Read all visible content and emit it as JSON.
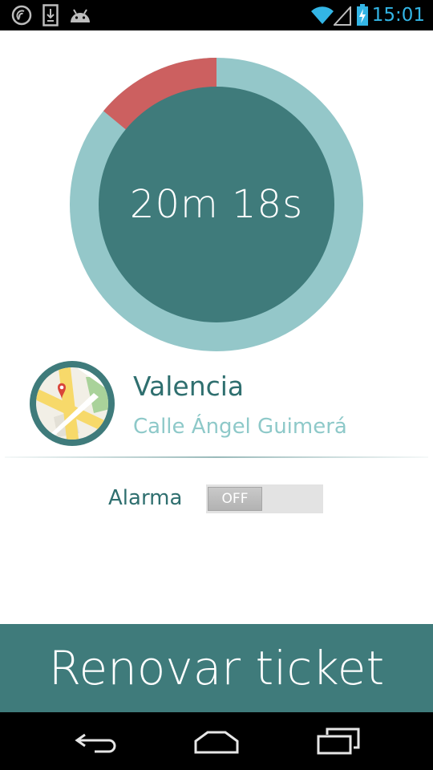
{
  "status_bar": {
    "time": "15:01",
    "left_icons": [
      "signal-scan-icon",
      "download-icon",
      "android-icon"
    ],
    "right_icons": [
      "wifi-icon",
      "cell-signal-icon",
      "battery-charging-icon"
    ],
    "accent_color": "#33b5e5"
  },
  "timer": {
    "remaining": "20m 18s",
    "elapsed_fraction": 0.14,
    "colors": {
      "ring": "#94c7c9",
      "elapsed": "#cc6060",
      "center": "#3f7b7b"
    }
  },
  "location": {
    "icon": "map-icon",
    "city": "Valencia",
    "street": "Calle Ángel Guimerá"
  },
  "alarm": {
    "label": "Alarma",
    "toggle_state": "OFF"
  },
  "action": {
    "renew_label": "Renovar ticket",
    "color": "#3f7b7b"
  },
  "nav_bar": {
    "buttons": [
      "back-icon",
      "home-icon",
      "recent-apps-icon"
    ]
  }
}
